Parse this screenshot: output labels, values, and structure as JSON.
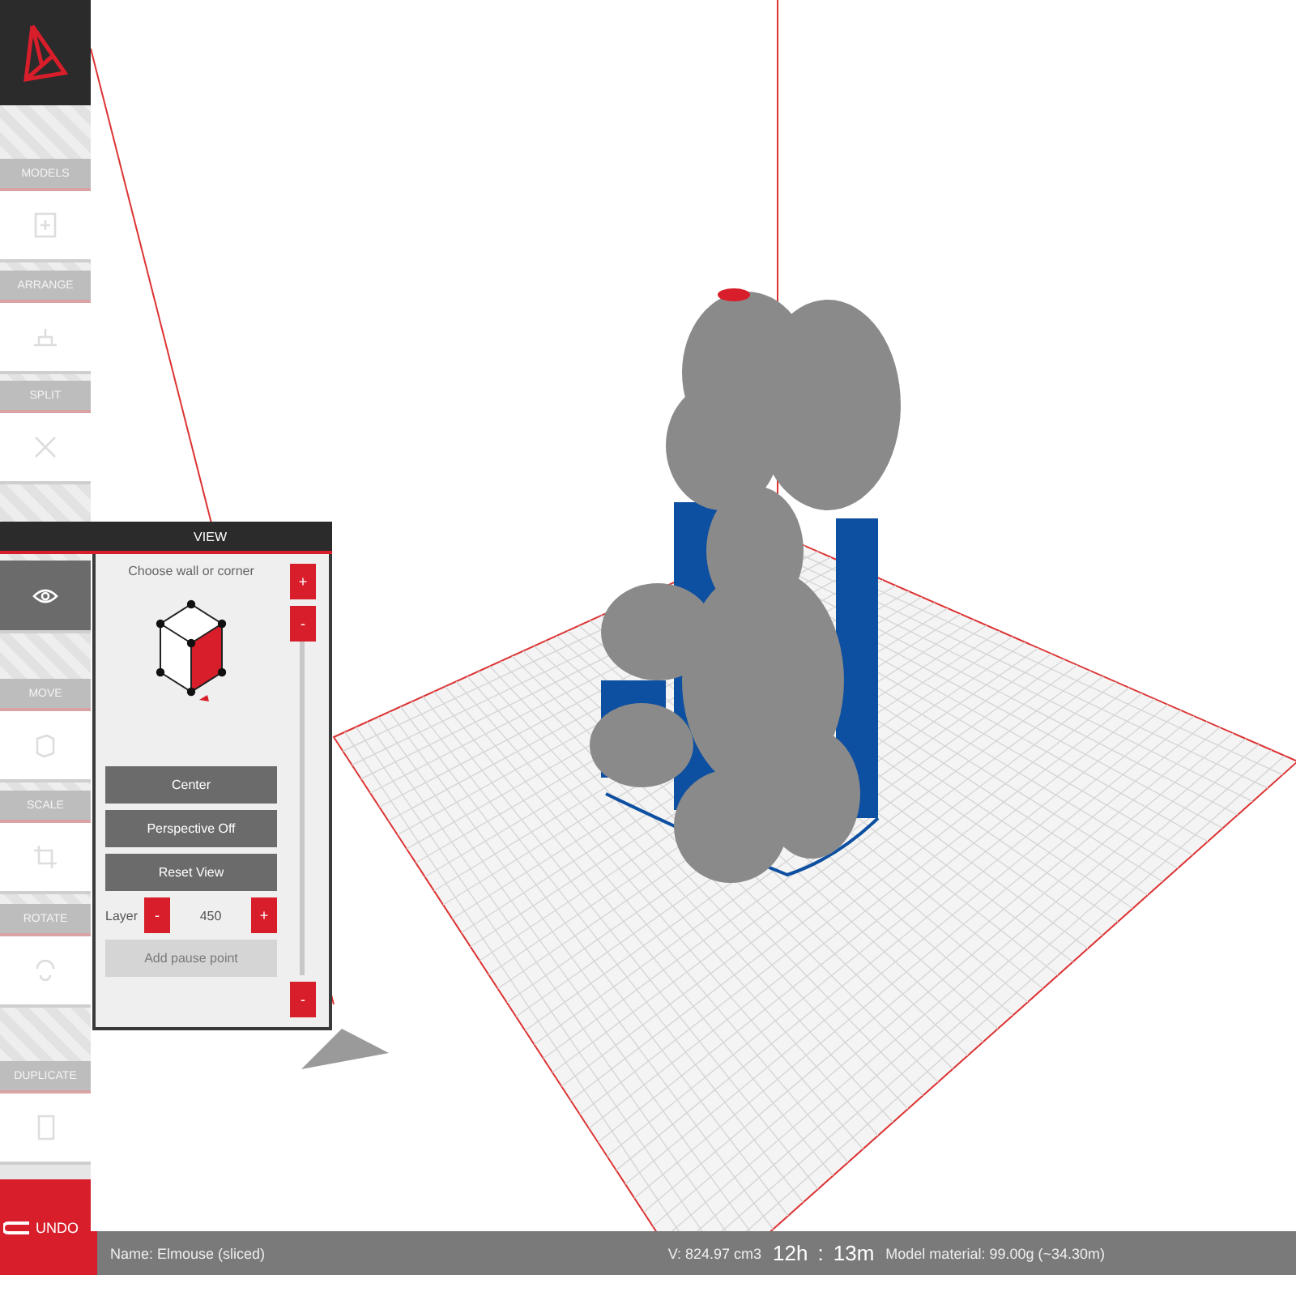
{
  "sidebar": {
    "tools": [
      {
        "kind": "labeled",
        "label": "MODELS",
        "selected": false
      },
      {
        "kind": "labeled",
        "label": "ARRANGE",
        "selected": false
      },
      {
        "kind": "labeled",
        "label": "SPLIT",
        "selected": false
      },
      {
        "kind": "view",
        "selected": true
      },
      {
        "kind": "labeled",
        "label": "MOVE",
        "selected": false
      },
      {
        "kind": "labeled",
        "label": "SCALE",
        "selected": false
      },
      {
        "kind": "labeled",
        "label": "ROTATE",
        "selected": false
      },
      {
        "kind": "labeled",
        "label": "DUPLICATE",
        "selected": false
      }
    ],
    "undo": "UNDO"
  },
  "view_panel": {
    "title": "VIEW",
    "prompt": "Choose wall or corner",
    "buttons": [
      {
        "label": "Center",
        "disabled": false
      },
      {
        "label": "Perspective Off",
        "disabled": false
      },
      {
        "label": "Reset View",
        "disabled": false
      }
    ],
    "layer": {
      "label": "Layer",
      "value": "450",
      "minus": "-",
      "plus": "+"
    },
    "pause_button": {
      "label": "Add pause point",
      "disabled": true
    },
    "slider": {
      "top_button": "+",
      "thumb": "-",
      "bottom_button": "-",
      "level": 1
    }
  },
  "status_bar": {
    "name": "Name: Elmouse (sliced)",
    "volume": "V: 824.97 cm3",
    "hours": "12h",
    "separator": ":",
    "minutes": "13m",
    "material": "Model material: 99.00g (~34.30m)"
  }
}
